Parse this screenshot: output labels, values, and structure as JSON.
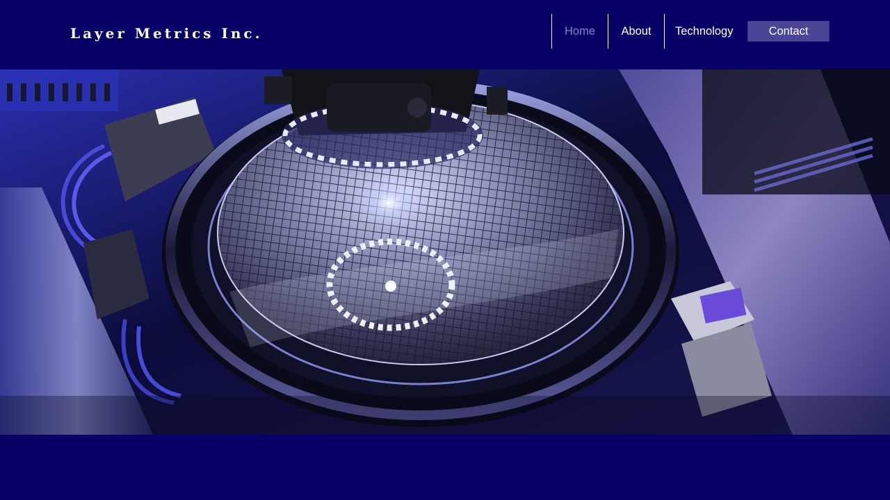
{
  "brand": {
    "name": "Layer Metrics Inc."
  },
  "nav": {
    "items": [
      {
        "label": "Home",
        "active": true
      },
      {
        "label": "About",
        "active": false
      },
      {
        "label": "Technology",
        "active": false
      }
    ],
    "contact_label": "Contact"
  },
  "hero": {
    "image": "semiconductor wafer inspection machine with illuminated camera ring"
  },
  "colors": {
    "background": "#070066",
    "nav_active": "#8a86bf",
    "contact_button": "#4b4596",
    "text": "#ffffff"
  }
}
